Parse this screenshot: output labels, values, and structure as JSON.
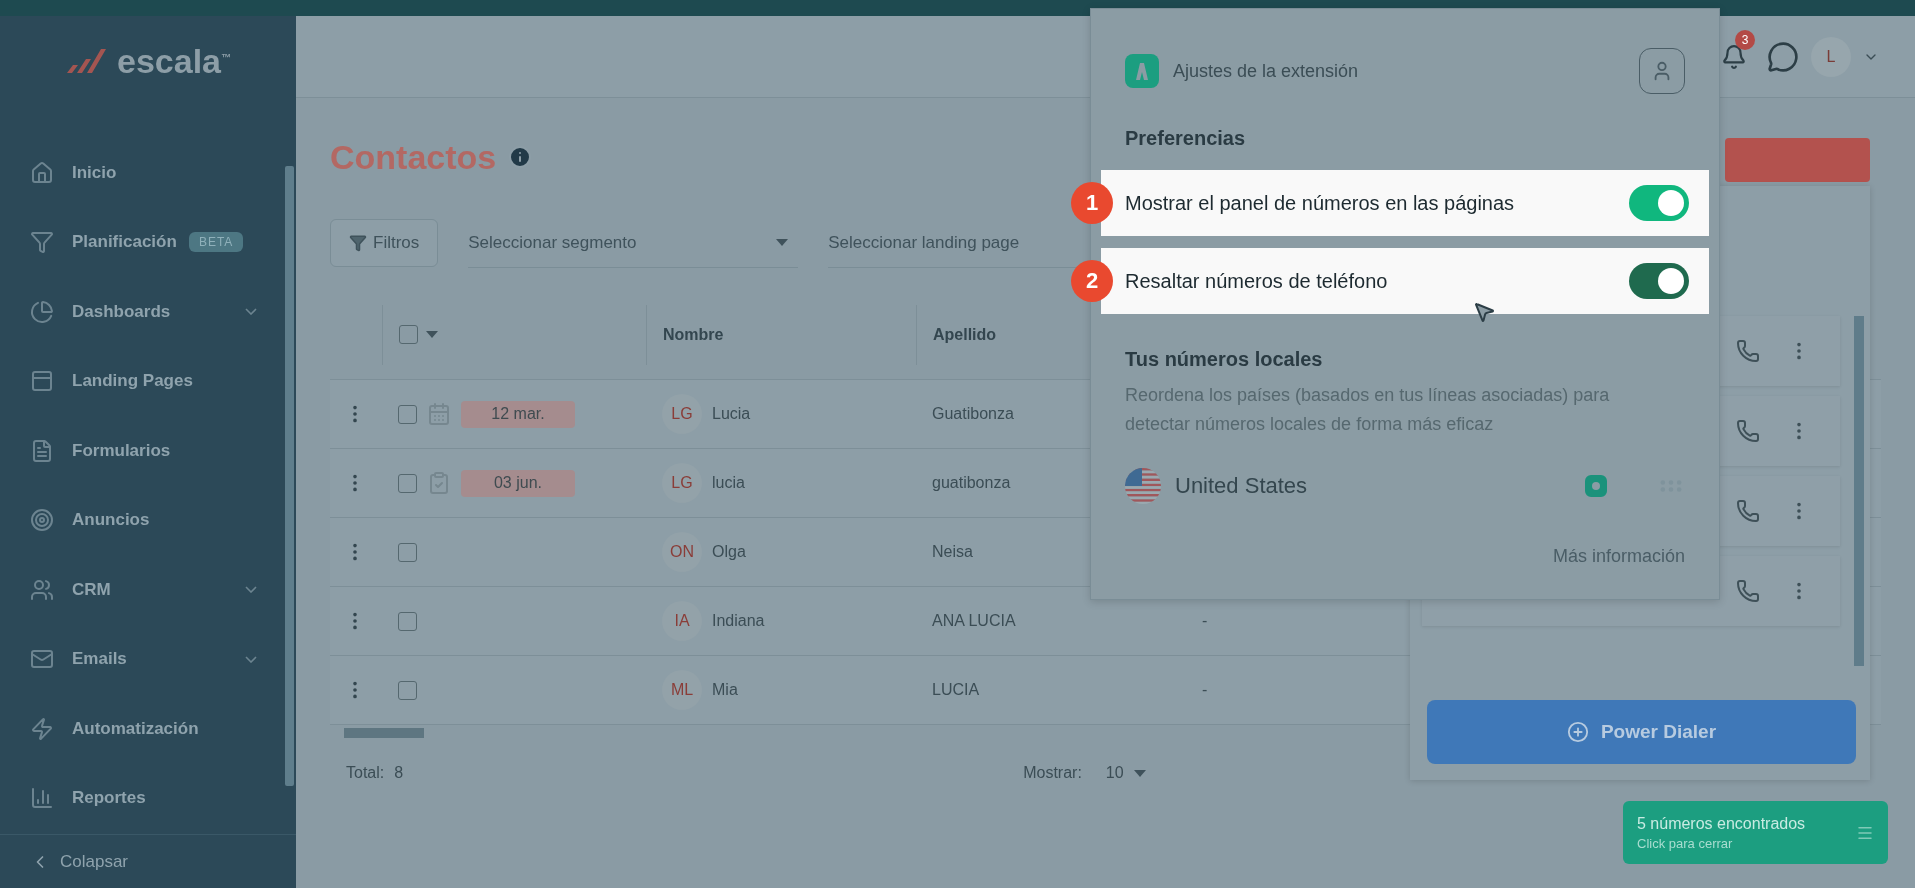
{
  "sidebar": {
    "logo": "escala",
    "logo_mark": "™",
    "items": [
      {
        "label": "Inicio",
        "expandable": false
      },
      {
        "label": "Planificación",
        "badge": "BETA",
        "expandable": false
      },
      {
        "label": "Dashboards",
        "expandable": true
      },
      {
        "label": "Landing Pages",
        "expandable": false
      },
      {
        "label": "Formularios",
        "expandable": false
      },
      {
        "label": "Anuncios",
        "expandable": false
      },
      {
        "label": "CRM",
        "expandable": true
      },
      {
        "label": "Emails",
        "expandable": true
      },
      {
        "label": "Automatización",
        "expandable": false
      },
      {
        "label": "Reportes",
        "expandable": false
      }
    ],
    "collapse": "Colapsar"
  },
  "topbar": {
    "notifications": "3",
    "avatar": "L"
  },
  "page": {
    "title": "Contactos",
    "filters_button": "Filtros",
    "segment_select": {
      "placeholder": "Seleccionar segmento"
    },
    "landing_select": {
      "placeholder": "Seleccionar landing page"
    }
  },
  "table": {
    "columns": [
      "Nombre",
      "Apellido"
    ],
    "rows": [
      {
        "checked": false,
        "date": "12 mar.",
        "kind": "calendar",
        "initials": "LG",
        "name": "Lucia",
        "surname": "Guatibonza"
      },
      {
        "checked": false,
        "date": "03 jun.",
        "kind": "task",
        "initials": "LG",
        "name": "lucia",
        "surname": "guatibonza"
      },
      {
        "checked": false,
        "kind": "plain",
        "initials": "ON",
        "name": "Olga",
        "surname": "Neisa"
      },
      {
        "checked": false,
        "kind": "plain",
        "initials": "IA",
        "name": "Indiana",
        "surname": "ANA LUCIA",
        "column_4": "-"
      },
      {
        "checked": false,
        "kind": "plain",
        "initials": "ML",
        "name": "Mia",
        "surname": "LUCIA",
        "column_4": "-"
      }
    ],
    "all_checked": false,
    "total_label": "Total:",
    "total": "8",
    "show_label": "Mostrar:",
    "show_value": "10"
  },
  "extension": {
    "title": "Ajustes de la extensión",
    "preferences_heading": "Preferencias",
    "options": [
      {
        "step": "1",
        "label": "Mostrar el panel de números en las páginas",
        "on": true,
        "color": "#10b77e"
      },
      {
        "step": "2",
        "label": "Resaltar números de teléfono",
        "on": true,
        "color": "#1f6a4e"
      }
    ],
    "local_heading": "Tus números locales",
    "local_description": "Reordena los países (basados en tus líneas asociadas) para detectar números locales de forma más eficaz",
    "countries": [
      {
        "name": "United States",
        "selected": true
      }
    ],
    "more_link": "Más información"
  },
  "dialer": {
    "button": "Power Dialer"
  },
  "found_badge": {
    "title": "5 números encontrados",
    "subtitle": "Click para cerrar"
  }
}
